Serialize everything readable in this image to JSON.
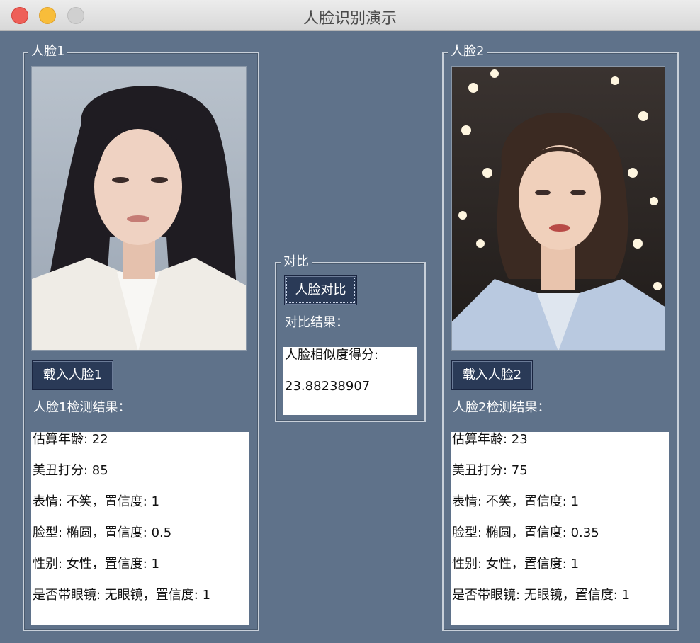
{
  "window": {
    "title": "人脸识别演示"
  },
  "face1": {
    "group_label": "人脸1",
    "load_button": "载入人脸1",
    "result_label": "人脸1检测结果：",
    "results": [
      "估算年龄: 22",
      "美丑打分: 85",
      "表情: 不笑，置信度: 1",
      "脸型: 椭圆，置信度: 0.5",
      "性别: 女性，置信度: 1",
      "是否带眼镜: 无眼镜，置信度: 1"
    ]
  },
  "compare": {
    "group_label": "对比",
    "button": "人脸对比",
    "result_label": "对比结果：",
    "result_lines": [
      "人脸相似度得分:",
      "23.88238907"
    ]
  },
  "face2": {
    "group_label": "人脸2",
    "load_button": "载入人脸2",
    "result_label": "人脸2检测结果：",
    "results": [
      "估算年龄: 23",
      "美丑打分: 75",
      "表情: 不笑，置信度: 1",
      "脸型: 椭圆，置信度: 0.35",
      "性别: 女性，置信度: 1",
      "是否带眼镜: 无眼镜，置信度: 1"
    ]
  },
  "colors": {
    "window_bg": "#5f728a",
    "button_bg": "#2a3a57",
    "close": "#ee5f58",
    "minimize": "#f8bd3a",
    "maximize": "#d0d0d0"
  }
}
